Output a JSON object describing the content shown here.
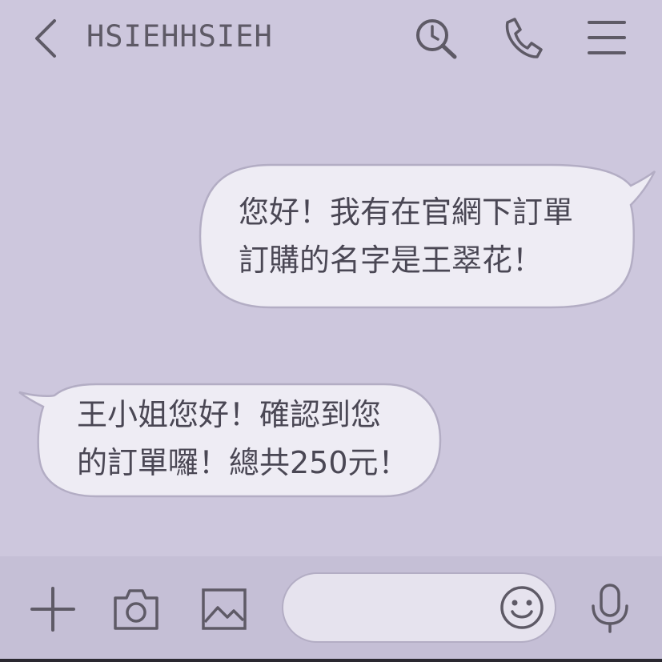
{
  "header": {
    "title": "HSIEHHSIEH",
    "icons": [
      "back-arrow-icon",
      "search-icon",
      "phone-icon",
      "menu-icon"
    ]
  },
  "messages": [
    {
      "from": "me",
      "text": "您好！我有在官網下訂單\n訂購的名字是王翠花！"
    },
    {
      "from": "other",
      "text": "王小姐您好！確認到您\n的訂單囉！總共250元！"
    }
  ],
  "composer": {
    "input_value": "",
    "icons": [
      "plus-icon",
      "camera-icon",
      "image-icon",
      "emoji-icon",
      "microphone-icon"
    ]
  },
  "colors": {
    "background": "#cdc7dd",
    "bubble": "#eeecf4",
    "bubble_border": "#b3adc4",
    "icon": "#5e5a66",
    "text": "#4a4754"
  }
}
